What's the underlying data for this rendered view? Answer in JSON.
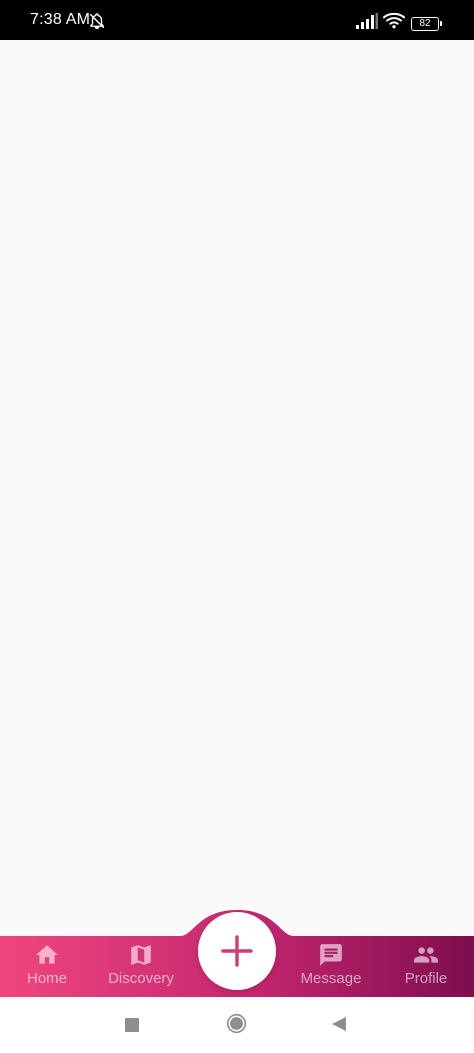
{
  "status_bar": {
    "time": "7:38 AM",
    "battery": "82",
    "icons": [
      "bell-off-icon",
      "signal-icon",
      "wifi-icon",
      "battery-icon"
    ]
  },
  "bottom_nav": {
    "items": [
      {
        "label": "Home",
        "icon": "home-icon"
      },
      {
        "label": "Discovery",
        "icon": "map-icon"
      },
      {
        "label": "Message",
        "icon": "message-icon"
      },
      {
        "label": "Profile",
        "icon": "people-icon"
      }
    ],
    "fab_icon": "plus-icon",
    "gradient_start": "#f0467f",
    "gradient_end": "#7d0e4e",
    "fab_plus_color": "#d03c77"
  },
  "system_nav": {
    "icons": [
      "recents-square-icon",
      "home-circle-icon",
      "back-triangle-icon"
    ]
  }
}
